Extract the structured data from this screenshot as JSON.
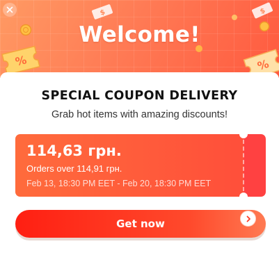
{
  "banner": {
    "title": "Welcome!"
  },
  "icons": {
    "close": "close-icon",
    "arrow": "chevron-right-icon",
    "decorations": [
      "coupon-ticket-icon",
      "coin-icon",
      "money-bill-icon"
    ]
  },
  "colors": {
    "banner_start": "#ff9a63",
    "banner_end": "#ff5a3f",
    "coupon": "#ff4f3a",
    "button": "#ff1f12"
  },
  "content": {
    "title": "SPECIAL COUPON DELIVERY",
    "subtitle": "Grab hot items with amazing discounts!"
  },
  "coupon": {
    "amount": "114,63 грн.",
    "min_order": "Orders over 114,91 грн.",
    "validity": "Feb 13, 18:30 PM EET - Feb 20, 18:30 PM EET"
  },
  "cta": {
    "label": "Get now"
  }
}
